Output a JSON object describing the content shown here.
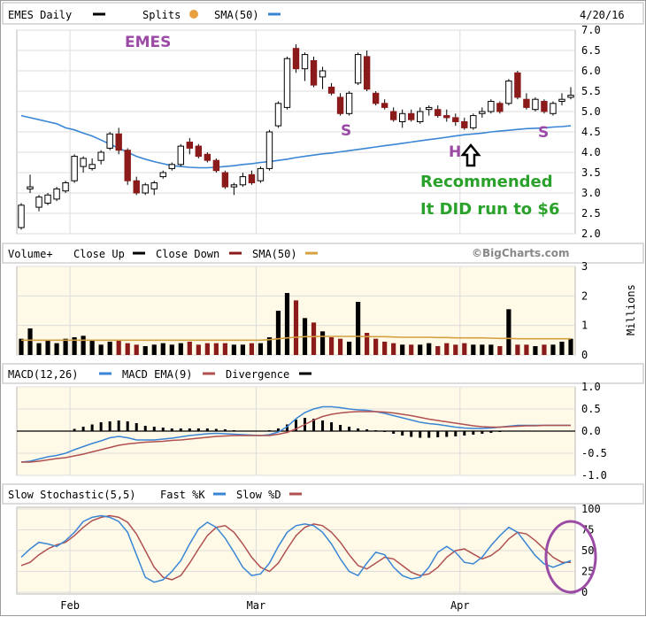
{
  "header": {
    "title": "EMES Daily",
    "splits_label": "Splits",
    "sma_label": "SMA(50)",
    "date": "4/20/16"
  },
  "volume_header": {
    "title": "Volume+",
    "close_up": "Close Up",
    "close_down": "Close Down",
    "sma": "SMA(50)",
    "copyright": "©BigCharts.com",
    "units": "Millions"
  },
  "macd_header": {
    "macd": "MACD(12,26)",
    "ema": "MACD EMA(9)",
    "divergence": "Divergence"
  },
  "stoch_header": {
    "title": "Slow Stochastic(5,5)",
    "fast": "Fast %K",
    "slow": "Slow %D"
  },
  "annotations": {
    "symbol": "EMES",
    "s_left": "S",
    "h": "H",
    "s_right": "S",
    "recommended": "Recommended",
    "ran": "It DID run to $6"
  },
  "colors": {
    "up": "#000000",
    "down": "#8b1a1a",
    "sma_line": "#3a86d4",
    "vol_sma": "#d4a040",
    "macd": "#3a86d4",
    "ema": "#b05050",
    "panel_bg": "#fffae8",
    "annotation": "#9b4ba5",
    "green": "#2aa12a"
  },
  "chart_data": {
    "type": "candlestick",
    "x_tick_labels": [
      "Feb",
      "Mar",
      "Apr"
    ],
    "x_tick_sessions": [
      6,
      27,
      50
    ],
    "price": {
      "ylim": [
        2.0,
        7.0
      ],
      "yticks": [
        "2.0",
        "2.5",
        "3.0",
        "3.5",
        "4.0",
        "4.5",
        "5.0",
        "5.5",
        "6.0",
        "6.5",
        "7.0"
      ],
      "ohlc": [
        [
          2.15,
          2.75,
          2.1,
          2.7
        ],
        [
          3.1,
          3.45,
          3.0,
          3.15
        ],
        [
          2.65,
          2.95,
          2.55,
          2.9
        ],
        [
          2.75,
          3.0,
          2.7,
          2.95
        ],
        [
          2.85,
          3.15,
          2.8,
          3.1
        ],
        [
          3.05,
          3.3,
          3.0,
          3.25
        ],
        [
          3.3,
          3.95,
          3.25,
          3.9
        ],
        [
          3.65,
          3.9,
          3.5,
          3.85
        ],
        [
          3.6,
          3.85,
          3.55,
          3.7
        ],
        [
          3.8,
          4.05,
          3.7,
          4.0
        ],
        [
          4.1,
          4.5,
          4.05,
          4.45
        ],
        [
          4.45,
          4.6,
          3.95,
          4.05
        ],
        [
          4.05,
          4.1,
          3.2,
          3.3
        ],
        [
          3.3,
          3.4,
          2.95,
          3.0
        ],
        [
          3.0,
          3.25,
          2.95,
          3.2
        ],
        [
          3.1,
          3.3,
          2.95,
          3.25
        ],
        [
          3.4,
          3.55,
          3.35,
          3.5
        ],
        [
          3.6,
          3.75,
          3.55,
          3.7
        ],
        [
          3.7,
          4.2,
          3.65,
          4.15
        ],
        [
          4.25,
          4.35,
          3.95,
          4.1
        ],
        [
          4.15,
          4.2,
          3.85,
          3.9
        ],
        [
          3.95,
          4.0,
          3.75,
          3.8
        ],
        [
          3.8,
          3.85,
          3.5,
          3.55
        ],
        [
          3.5,
          3.55,
          3.1,
          3.15
        ],
        [
          3.15,
          3.25,
          2.95,
          3.2
        ],
        [
          3.2,
          3.5,
          3.15,
          3.4
        ],
        [
          3.45,
          3.55,
          3.2,
          3.25
        ],
        [
          3.3,
          3.65,
          3.25,
          3.6
        ],
        [
          3.6,
          4.55,
          3.55,
          4.5
        ],
        [
          4.65,
          5.25,
          4.6,
          5.2
        ],
        [
          5.1,
          6.35,
          5.05,
          6.3
        ],
        [
          6.55,
          6.65,
          5.95,
          6.05
        ],
        [
          6.05,
          6.45,
          5.75,
          6.4
        ],
        [
          6.25,
          6.35,
          5.6,
          5.65
        ],
        [
          5.85,
          6.1,
          5.55,
          6.0
        ],
        [
          5.6,
          5.7,
          5.4,
          5.45
        ],
        [
          5.35,
          5.45,
          4.9,
          4.95
        ],
        [
          4.95,
          5.5,
          4.9,
          5.45
        ],
        [
          5.7,
          6.45,
          5.65,
          6.4
        ],
        [
          6.35,
          6.5,
          5.5,
          5.55
        ],
        [
          5.45,
          5.5,
          5.15,
          5.2
        ],
        [
          5.2,
          5.3,
          5.05,
          5.1
        ],
        [
          5.0,
          5.1,
          4.75,
          4.8
        ],
        [
          4.75,
          5.05,
          4.6,
          4.95
        ],
        [
          4.95,
          5.05,
          4.75,
          4.8
        ],
        [
          4.75,
          5.1,
          4.7,
          5.0
        ],
        [
          5.05,
          5.15,
          4.9,
          5.1
        ],
        [
          5.05,
          5.15,
          4.85,
          4.9
        ],
        [
          4.9,
          5.05,
          4.75,
          4.85
        ],
        [
          4.85,
          4.95,
          4.65,
          4.75
        ],
        [
          4.75,
          4.85,
          4.55,
          4.6
        ],
        [
          4.6,
          4.95,
          4.55,
          4.9
        ],
        [
          4.95,
          5.1,
          4.85,
          5.0
        ],
        [
          5.0,
          5.3,
          4.95,
          5.25
        ],
        [
          5.2,
          5.25,
          4.95,
          5.0
        ],
        [
          5.2,
          5.8,
          5.15,
          5.75
        ],
        [
          5.95,
          6.0,
          5.3,
          5.35
        ],
        [
          5.3,
          5.45,
          5.05,
          5.1
        ],
        [
          5.05,
          5.35,
          5.0,
          5.3
        ],
        [
          5.25,
          5.3,
          4.95,
          5.0
        ],
        [
          4.95,
          5.25,
          4.9,
          5.2
        ],
        [
          5.25,
          5.45,
          5.15,
          5.3
        ],
        [
          5.35,
          5.6,
          5.3,
          5.4
        ]
      ],
      "sma50": [
        4.9,
        4.85,
        4.8,
        4.75,
        4.7,
        4.6,
        4.55,
        4.47,
        4.4,
        4.3,
        4.2,
        4.1,
        4.0,
        3.9,
        3.83,
        3.77,
        3.72,
        3.67,
        3.65,
        3.63,
        3.62,
        3.62,
        3.63,
        3.65,
        3.67,
        3.7,
        3.72,
        3.75,
        3.77,
        3.8,
        3.83,
        3.87,
        3.9,
        3.93,
        3.96,
        3.98,
        4.01,
        4.04,
        4.07,
        4.1,
        4.13,
        4.16,
        4.19,
        4.22,
        4.25,
        4.28,
        4.31,
        4.34,
        4.37,
        4.4,
        4.43,
        4.45,
        4.47,
        4.5,
        4.52,
        4.54,
        4.56,
        4.58,
        4.59,
        4.6,
        4.62,
        4.63,
        4.65
      ]
    },
    "volume": {
      "ylim": [
        0,
        3
      ],
      "yticks": [
        "0",
        "1",
        "2",
        "3"
      ],
      "values": [
        0.55,
        0.9,
        0.4,
        0.5,
        0.4,
        0.55,
        0.6,
        0.65,
        0.5,
        0.35,
        0.45,
        0.5,
        0.4,
        0.35,
        0.3,
        0.35,
        0.4,
        0.35,
        0.4,
        0.45,
        0.35,
        0.4,
        0.4,
        0.4,
        0.35,
        0.35,
        0.4,
        0.4,
        0.6,
        1.5,
        2.1,
        1.85,
        1.25,
        1.1,
        0.8,
        0.6,
        0.55,
        0.45,
        1.8,
        0.75,
        0.55,
        0.45,
        0.4,
        0.35,
        0.35,
        0.35,
        0.4,
        0.3,
        0.4,
        0.35,
        0.4,
        0.35,
        0.35,
        0.35,
        0.3,
        1.55,
        0.35,
        0.35,
        0.3,
        0.35,
        0.35,
        0.45,
        0.55
      ],
      "sma": [
        0.5,
        0.5,
        0.5,
        0.5,
        0.5,
        0.5,
        0.5,
        0.5,
        0.5,
        0.5,
        0.5,
        0.5,
        0.5,
        0.5,
        0.5,
        0.5,
        0.5,
        0.5,
        0.5,
        0.5,
        0.5,
        0.5,
        0.5,
        0.5,
        0.5,
        0.5,
        0.5,
        0.5,
        0.52,
        0.55,
        0.58,
        0.6,
        0.62,
        0.62,
        0.63,
        0.63,
        0.63,
        0.63,
        0.63,
        0.62,
        0.62,
        0.62,
        0.61,
        0.6,
        0.6,
        0.6,
        0.6,
        0.59,
        0.59,
        0.58,
        0.58,
        0.58,
        0.58,
        0.57,
        0.56,
        0.56,
        0.55,
        0.55,
        0.55,
        0.55,
        0.55,
        0.55,
        0.55
      ]
    },
    "macd": {
      "ylim": [
        -1.0,
        1.0
      ],
      "yticks": [
        "1.0",
        "0.5",
        "0.0",
        "-0.5",
        "-1.0"
      ],
      "macd": [
        -0.7,
        -0.68,
        -0.63,
        -0.58,
        -0.55,
        -0.5,
        -0.42,
        -0.35,
        -0.28,
        -0.22,
        -0.15,
        -0.12,
        -0.15,
        -0.2,
        -0.2,
        -0.2,
        -0.18,
        -0.16,
        -0.13,
        -0.1,
        -0.08,
        -0.06,
        -0.05,
        -0.06,
        -0.07,
        -0.08,
        -0.09,
        -0.1,
        -0.08,
        -0.02,
        0.1,
        0.28,
        0.42,
        0.5,
        0.55,
        0.55,
        0.53,
        0.5,
        0.48,
        0.47,
        0.44,
        0.4,
        0.35,
        0.3,
        0.25,
        0.2,
        0.17,
        0.15,
        0.12,
        0.09,
        0.07,
        0.06,
        0.06,
        0.07,
        0.09,
        0.11,
        0.13,
        0.13,
        0.13,
        0.13,
        0.13,
        0.13,
        0.13
      ],
      "ema": [
        -0.7,
        -0.7,
        -0.68,
        -0.65,
        -0.62,
        -0.6,
        -0.56,
        -0.52,
        -0.47,
        -0.42,
        -0.37,
        -0.32,
        -0.29,
        -0.27,
        -0.25,
        -0.24,
        -0.23,
        -0.21,
        -0.2,
        -0.18,
        -0.16,
        -0.14,
        -0.12,
        -0.11,
        -0.1,
        -0.1,
        -0.1,
        -0.1,
        -0.1,
        -0.07,
        -0.03,
        0.05,
        0.15,
        0.25,
        0.33,
        0.38,
        0.41,
        0.43,
        0.44,
        0.44,
        0.44,
        0.43,
        0.41,
        0.38,
        0.35,
        0.31,
        0.27,
        0.24,
        0.21,
        0.18,
        0.15,
        0.12,
        0.1,
        0.09,
        0.09,
        0.1,
        0.11,
        0.12,
        0.12,
        0.13,
        0.13,
        0.13,
        0.13
      ],
      "divergence": [
        0,
        0,
        0,
        0,
        0,
        0,
        0.05,
        0.1,
        0.15,
        0.2,
        0.22,
        0.24,
        0.22,
        0.18,
        0.12,
        0.1,
        0.08,
        0.06,
        0.06,
        0.06,
        0.06,
        0.06,
        0.05,
        0.04,
        0.02,
        0.01,
        0.01,
        0,
        0.02,
        0.06,
        0.15,
        0.26,
        0.3,
        0.28,
        0.24,
        0.2,
        0.14,
        0.1,
        0.06,
        0.04,
        0.02,
        -0.02,
        -0.06,
        -0.1,
        -0.13,
        -0.15,
        -0.15,
        -0.14,
        -0.13,
        -0.12,
        -0.1,
        -0.08,
        -0.06,
        -0.04,
        -0.02,
        0,
        0,
        0,
        0,
        0,
        0,
        0,
        0
      ]
    },
    "stochastic": {
      "ylim": [
        0,
        100
      ],
      "yticks": [
        "100",
        "75",
        "50",
        "25",
        "0"
      ],
      "fast_k": [
        42,
        52,
        60,
        58,
        55,
        62,
        72,
        85,
        90,
        92,
        90,
        85,
        72,
        45,
        18,
        12,
        15,
        25,
        38,
        58,
        76,
        84,
        78,
        65,
        48,
        30,
        20,
        22,
        35,
        55,
        72,
        80,
        82,
        80,
        72,
        58,
        40,
        25,
        20,
        35,
        48,
        45,
        30,
        20,
        16,
        18,
        30,
        48,
        55,
        48,
        36,
        34,
        42,
        56,
        68,
        78,
        72,
        58,
        44,
        34,
        30,
        34,
        38
      ],
      "slow_d": [
        32,
        36,
        45,
        52,
        57,
        60,
        68,
        78,
        86,
        90,
        92,
        90,
        84,
        70,
        50,
        30,
        18,
        15,
        20,
        35,
        52,
        68,
        78,
        80,
        72,
        58,
        42,
        30,
        25,
        35,
        52,
        68,
        78,
        82,
        80,
        72,
        60,
        45,
        32,
        28,
        35,
        42,
        40,
        32,
        24,
        20,
        22,
        30,
        42,
        50,
        52,
        46,
        40,
        44,
        52,
        64,
        72,
        70,
        62,
        52,
        42,
        36,
        36
      ]
    }
  }
}
